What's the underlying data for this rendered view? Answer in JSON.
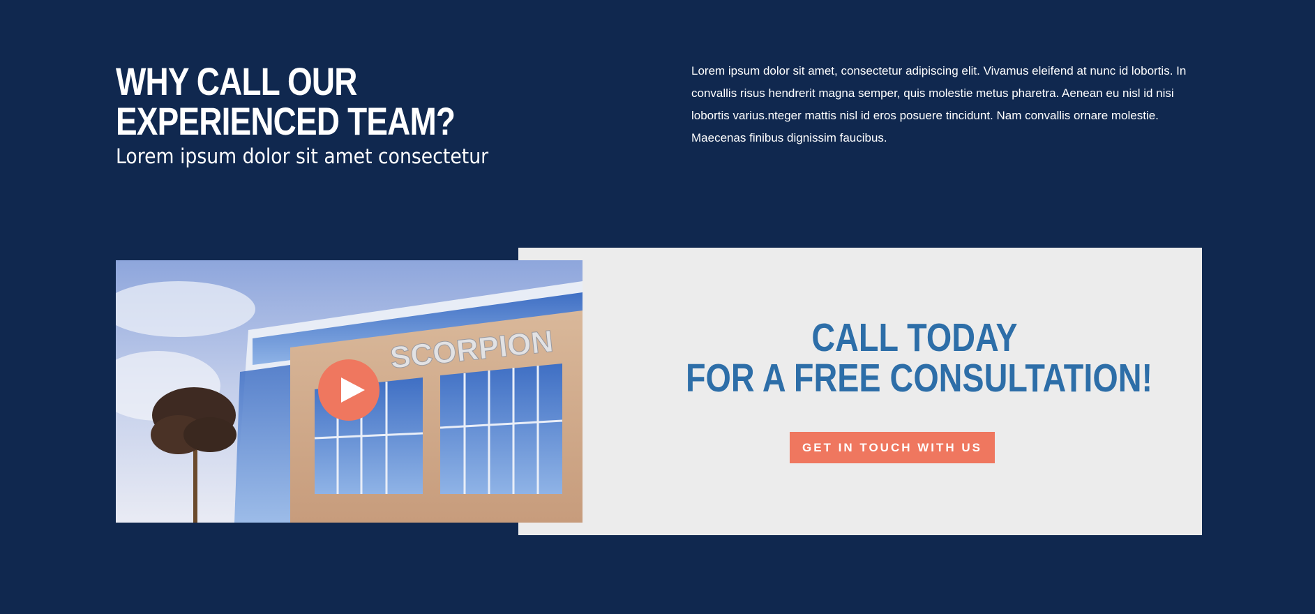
{
  "intro": {
    "heading_line1": "WHY CALL OUR",
    "heading_line2": "EXPERIENCED TEAM?",
    "subheading": "Lorem ipsum dolor sit amet consectetur",
    "body": "Lorem ipsum dolor sit amet, consectetur adipiscing elit. Vivamus eleifend at nunc id lobortis. In convallis risus hendrerit magna semper, quis molestie metus pharetra. Aenean eu nisl id nisi lobortis varius.nteger mattis nisl id eros posuere tincidunt. Nam convallis ornare molestie. Maecenas finibus dignissim faucibus."
  },
  "video": {
    "sign_text": "SCORPION",
    "play_icon": "play-icon"
  },
  "cta": {
    "title_line1": "CALL TODAY",
    "title_line2": "FOR A FREE CONSULTATION!",
    "button_label": "GET IN TOUCH WITH US"
  },
  "colors": {
    "background": "#10284f",
    "panel": "#ececec",
    "accent": "#ef775f",
    "title_blue": "#2d6ea8"
  }
}
